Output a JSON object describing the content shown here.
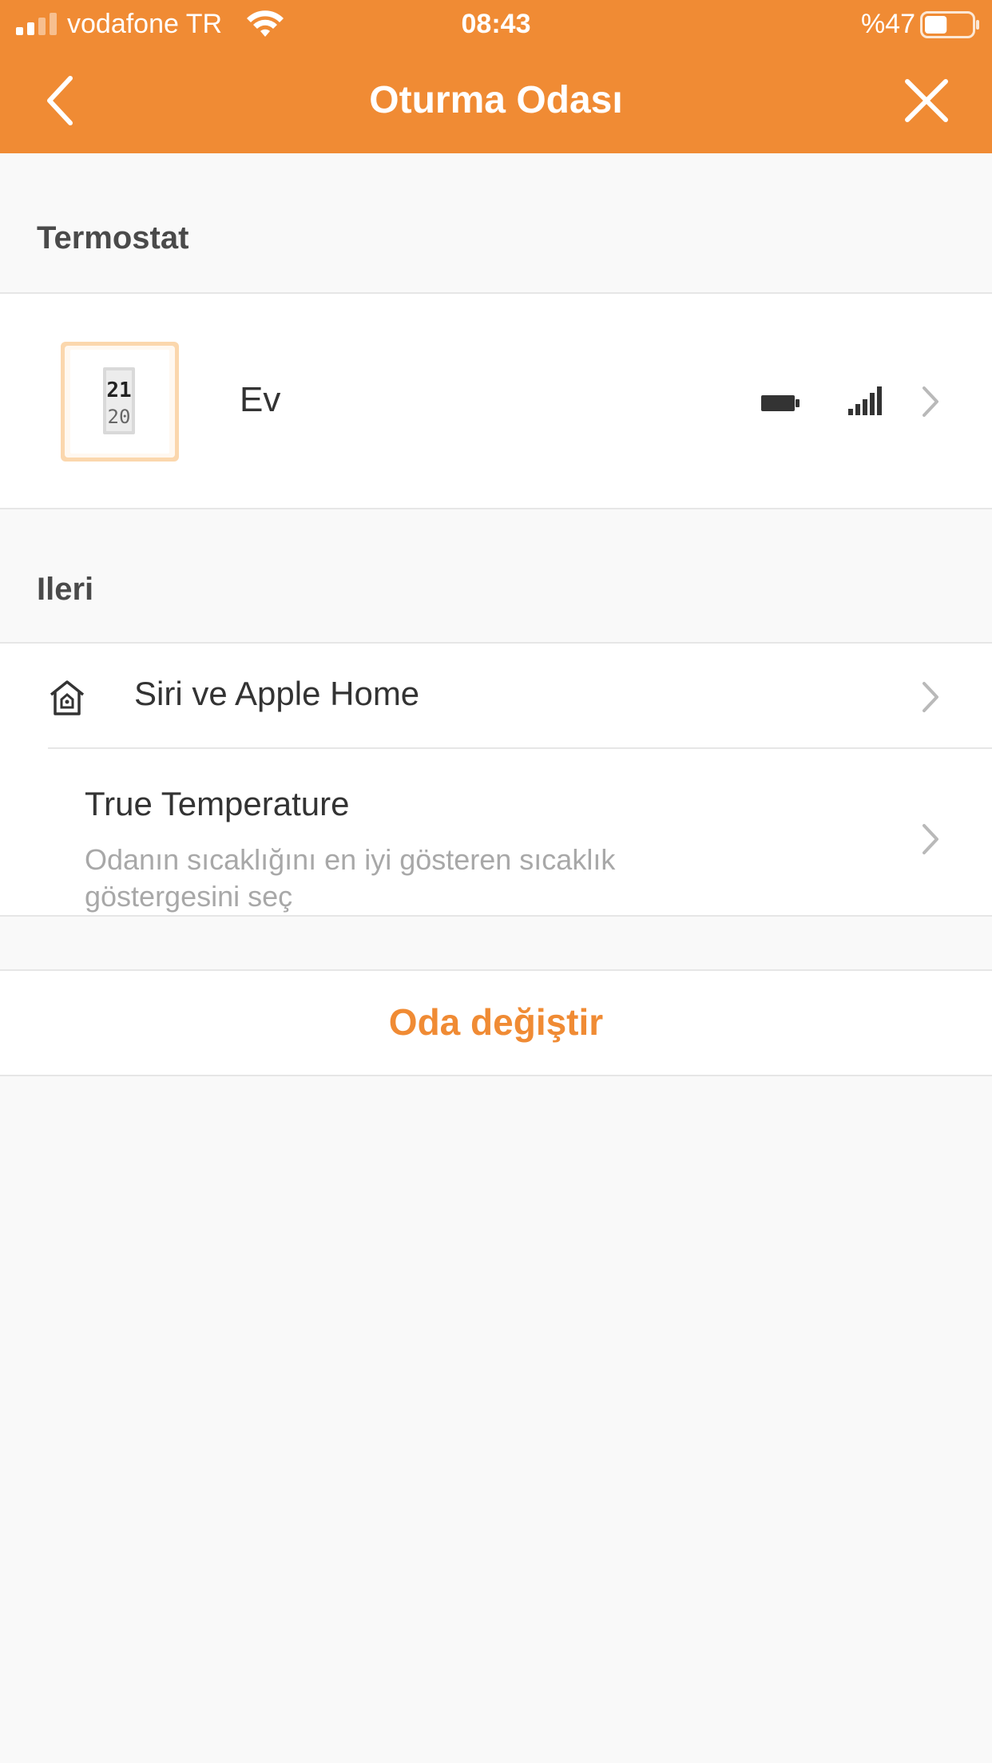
{
  "status_bar": {
    "carrier": "vodafone TR",
    "time": "08:43",
    "battery_percent": "%47",
    "battery_level": 0.47,
    "signal_bars": 3,
    "icons": [
      "signal-icon",
      "wifi-icon",
      "battery-icon"
    ]
  },
  "nav": {
    "title": "Oturma Odası",
    "back_icon": "chevron-left-icon",
    "close_icon": "close-icon"
  },
  "thermostat_section": {
    "header": "Termostat",
    "device": {
      "name": "Ev",
      "display_top": "21",
      "display_bottom": "20",
      "icons": [
        "battery-icon",
        "signal-icon",
        "chevron-right-icon"
      ]
    }
  },
  "advanced_section": {
    "header": "Ileri",
    "items": [
      {
        "title": "Siri ve Apple Home",
        "icon": "home-icon"
      },
      {
        "title": "True Temperature",
        "subtitle": "Odanın sıcaklığını en iyi gösteren sıcaklık göstergesini seç"
      }
    ]
  },
  "actions": {
    "change_room": "Oda değiştir"
  },
  "colors": {
    "accent": "#f08b34",
    "background": "#f9f9f9",
    "card": "#ffffff",
    "divider": "#e6e6e6",
    "text": "#333333",
    "muted": "#a8a8a8"
  }
}
